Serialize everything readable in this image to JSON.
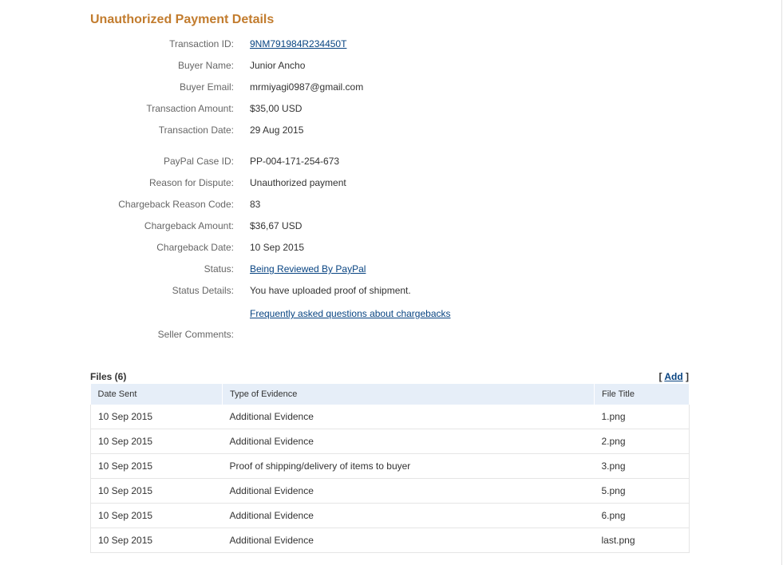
{
  "page_title": "Unauthorized Payment Details",
  "details": {
    "transaction_id": {
      "label": "Transaction ID:",
      "value": "9NM791984R234450T"
    },
    "buyer_name": {
      "label": "Buyer Name:",
      "value": "Junior Ancho"
    },
    "buyer_email": {
      "label": "Buyer Email:",
      "value": "mrmiyagi0987@gmail.com"
    },
    "transaction_amount": {
      "label": "Transaction Amount:",
      "value": "$35,00 USD"
    },
    "transaction_date": {
      "label": "Transaction Date:",
      "value": "29 Aug 2015"
    },
    "case_id": {
      "label": "PayPal Case ID:",
      "value": "PP-004-171-254-673"
    },
    "reason": {
      "label": "Reason for Dispute:",
      "value": "Unauthorized payment"
    },
    "reason_code": {
      "label": "Chargeback Reason Code:",
      "value": "83"
    },
    "chargeback_amount": {
      "label": "Chargeback Amount:",
      "value": "$36,67 USD"
    },
    "chargeback_date": {
      "label": "Chargeback Date:",
      "value": "10 Sep 2015"
    },
    "status": {
      "label": "Status:",
      "value": "Being Reviewed By PayPal"
    },
    "status_details": {
      "label": "Status Details:",
      "value": "You have uploaded proof of shipment."
    },
    "faq_link": "Frequently asked questions about chargebacks",
    "seller_comments": {
      "label": "Seller Comments:",
      "value": ""
    }
  },
  "files": {
    "title": "Files (6)",
    "add_open": "[ ",
    "add_label": "Add",
    "add_close": " ]",
    "columns": [
      "Date Sent",
      "Type of Evidence",
      "File Title"
    ],
    "rows": [
      {
        "date": "10 Sep 2015",
        "type": "Additional Evidence",
        "file": "1.png"
      },
      {
        "date": "10 Sep 2015",
        "type": "Additional Evidence",
        "file": "2.png"
      },
      {
        "date": "10 Sep 2015",
        "type": "Proof of shipping/delivery of items to buyer",
        "file": "3.png"
      },
      {
        "date": "10 Sep 2015",
        "type": "Additional Evidence",
        "file": "5.png"
      },
      {
        "date": "10 Sep 2015",
        "type": "Additional Evidence",
        "file": "6.png"
      },
      {
        "date": "10 Sep 2015",
        "type": "Additional Evidence",
        "file": "last.png"
      }
    ]
  },
  "colors": {
    "title": "#c27c2e",
    "link": "#084482",
    "label": "#666666",
    "table_header_bg": "#e6eef8"
  }
}
